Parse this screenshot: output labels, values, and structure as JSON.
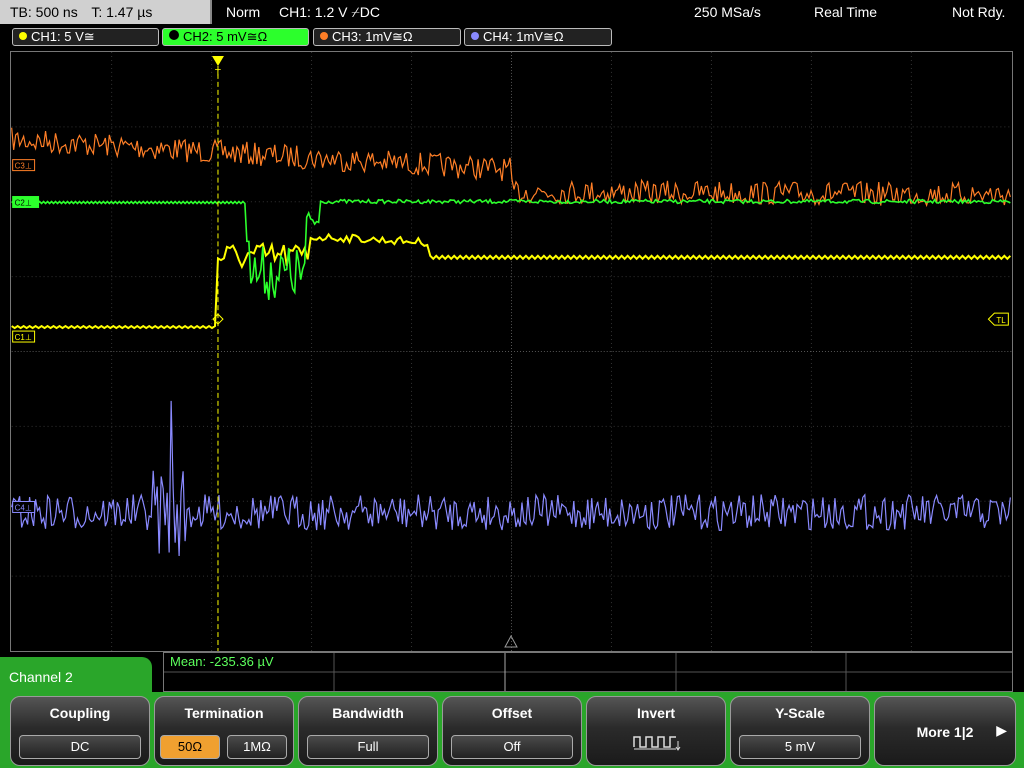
{
  "status": {
    "timebase": "TB: 500 ns",
    "trigger_time": "T: 1.47 µs",
    "trigger_mode": "Norm",
    "trigger_setting": "CH1: 1.2 V ⌿DC",
    "sample_rate": "250 MSa/s",
    "acq_mode": "Real Time",
    "ready_state": "Not Rdy."
  },
  "channels": [
    {
      "label": "CH1: 5 V≅",
      "color": "#ffff00",
      "active": false
    },
    {
      "label": "CH2: 5 mV≅Ω",
      "color": "#2cff2c",
      "active": true
    },
    {
      "label": "CH3: 1mV≅Ω",
      "color": "#ff7f27",
      "active": false
    },
    {
      "label": "CH4: 1mV≅Ω",
      "color": "#8a8aff",
      "active": false
    }
  ],
  "markers": {
    "c3": "C3⊥",
    "c2": "C2⊥",
    "c1": "C1⊥",
    "c4": "C4⊥",
    "trigger_level": "TL",
    "trigger_pos": "T"
  },
  "measurement": {
    "mean": "Mean: -235.36 µV"
  },
  "menu": {
    "title": "Channel 2",
    "coupling": {
      "label": "Coupling",
      "value": "DC"
    },
    "termination": {
      "label": "Termination",
      "opt1": "50Ω",
      "opt2": "1MΩ",
      "selected": "50Ω"
    },
    "bandwidth": {
      "label": "Bandwidth",
      "value": "Full"
    },
    "offset": {
      "label": "Offset",
      "value": "Off"
    },
    "invert": {
      "label": "Invert"
    },
    "yscale": {
      "label": "Y-Scale",
      "value": "5 mV"
    },
    "more": {
      "label": "More 1|2"
    }
  },
  "colors": {
    "ch1": "#ffff00",
    "ch2": "#2cff2c",
    "ch3": "#ff7f27",
    "ch4": "#8a8aff",
    "grid": "#3a3a3a",
    "menu": "#2aa62a",
    "selected": "#f0a030"
  }
}
